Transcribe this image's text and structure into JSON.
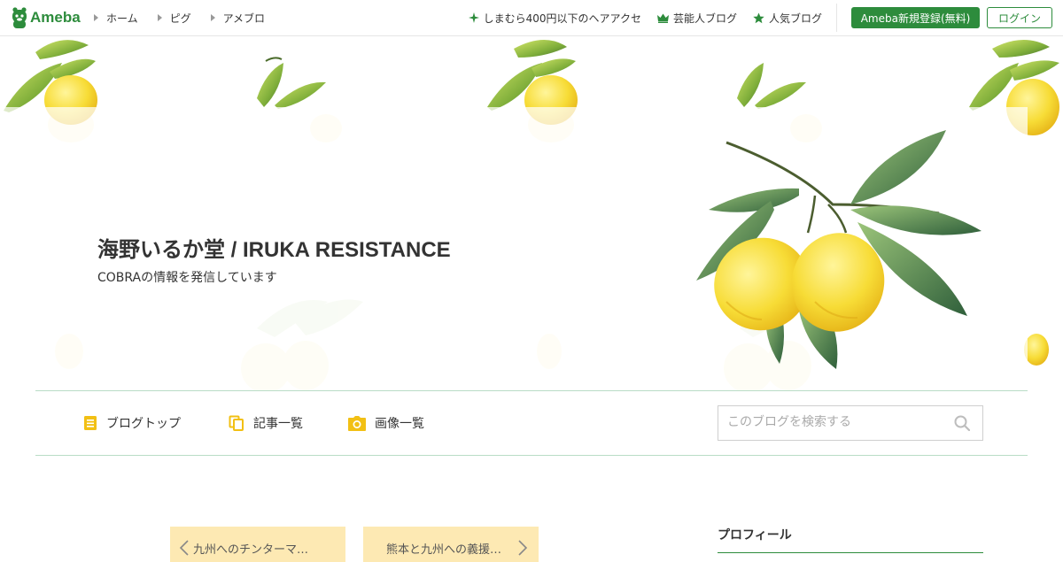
{
  "topbar": {
    "logo_text": "Ameba",
    "nav_left": [
      {
        "label": "ホーム"
      },
      {
        "label": "ピグ"
      },
      {
        "label": "アメブロ"
      }
    ],
    "nav_right": [
      {
        "label": "しまむら400円以下のヘアアクセ",
        "icon": "sparkle-icon"
      },
      {
        "label": "芸能人ブログ",
        "icon": "crown-icon"
      },
      {
        "label": "人気ブログ",
        "icon": "star-icon"
      }
    ],
    "signup_label": "Ameba新規登録(無料)",
    "login_label": "ログイン"
  },
  "header": {
    "title": "海野いるか堂 / IRUKA RESISTANCE",
    "description": "COBRAの情報を発信しています"
  },
  "blog_menu": {
    "items": [
      {
        "label": "ブログトップ",
        "icon": "document-icon"
      },
      {
        "label": "記事一覧",
        "icon": "copy-icon"
      },
      {
        "label": "画像一覧",
        "icon": "camera-icon"
      }
    ],
    "search_placeholder": "このブログを検索する"
  },
  "article_nav": {
    "prev_label": "九州へのチンターマ…",
    "next_label": "熊本と九州への義援…"
  },
  "sidebar": {
    "profile_title": "プロフィール"
  },
  "colors": {
    "brand_green": "#2d8c3c",
    "menu_icon": "#f2c014",
    "pager_bg": "#fde9b3",
    "divider": "#b9dcc6"
  }
}
